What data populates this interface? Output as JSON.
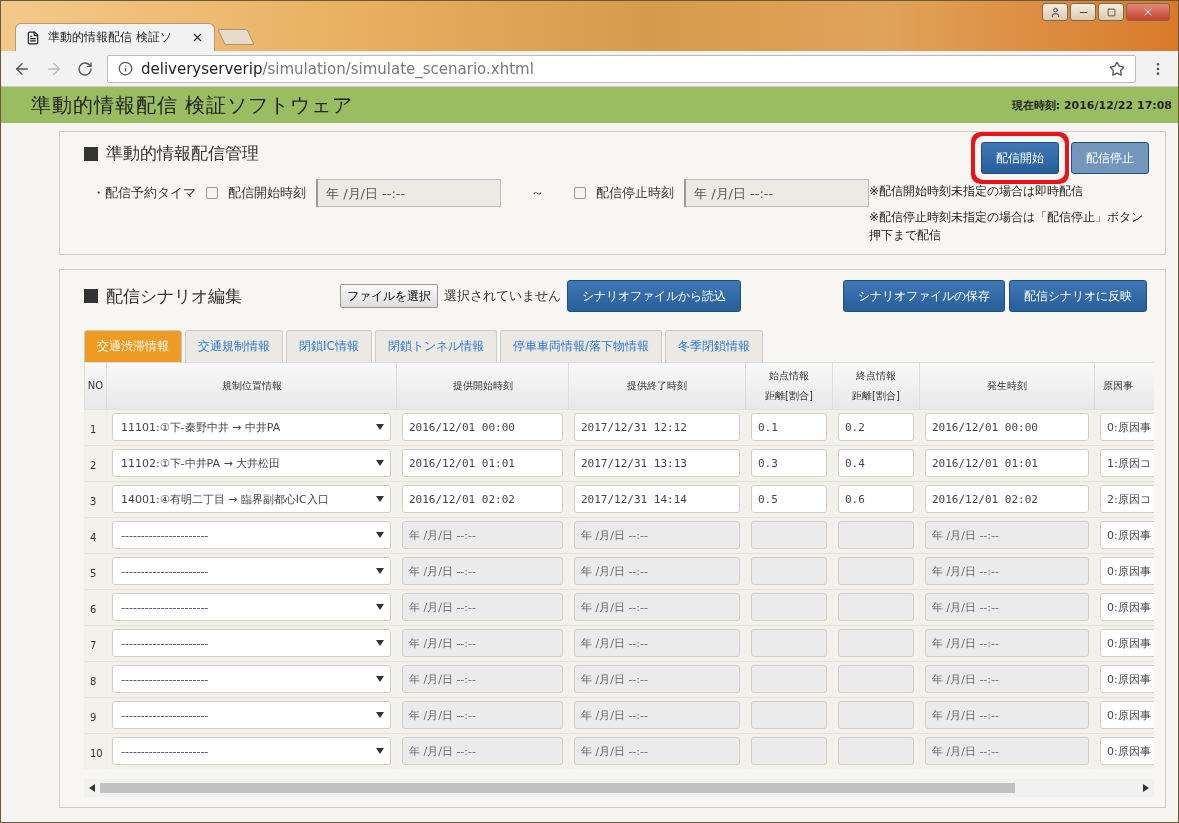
{
  "browser": {
    "tab_title": "準動的情報配信 検証ソ",
    "url_host": "deliveryserverip",
    "url_path": "/simulation/simulate_scenario.xhtml"
  },
  "header": {
    "title": "準動的情報配信 検証ソフトウェア",
    "clock_label": "現在時刻:",
    "clock_value": "2016/12/22 17:08"
  },
  "delivery": {
    "title": "準動的情報配信管理",
    "timer_label": "・配信予約タイマ",
    "timers": [
      {
        "label": "配信開始時刻",
        "checked": false,
        "placeholder": "年 /月/日 --:--"
      },
      {
        "label": "配信停止時刻",
        "checked": false,
        "placeholder": "年 /月/日 --:--"
      }
    ],
    "separator": "～",
    "buttons": [
      {
        "label": "配信開始",
        "highlighted": true,
        "disabled": false
      },
      {
        "label": "配信停止",
        "highlighted": false,
        "disabled": true
      }
    ],
    "notes": [
      "※配信開始時刻未指定の場合は即時配信",
      "※配信停止時刻未指定の場合は「配信停止」ボタン押下まで配信"
    ]
  },
  "scenario": {
    "title": "配信シナリオ編集",
    "file_button": "ファイルを選択",
    "file_status": "選択されていません",
    "load_button": "シナリオファイルから読込",
    "buttons": [
      "シナリオファイルの保存",
      "配信シナリオに反映"
    ],
    "tabs": [
      {
        "label": "交通渋滞情報",
        "selected": true
      },
      {
        "label": "交通規制情報",
        "selected": false
      },
      {
        "label": "閉鎖IC情報",
        "selected": false
      },
      {
        "label": "閉鎖トンネル情報",
        "selected": false
      },
      {
        "label": "停車車両情報/落下物情報",
        "selected": false
      },
      {
        "label": "冬季閉鎖情報",
        "selected": false
      }
    ],
    "columns": [
      {
        "label": "NO"
      },
      {
        "label": "規制位置情報"
      },
      {
        "label": "提供開始時刻"
      },
      {
        "label": "提供終了時刻"
      },
      {
        "label": "始点情報",
        "label_2": "距離[割合]"
      },
      {
        "label": "終点情報",
        "label_2": "距離[割合]"
      },
      {
        "label": "発生時刻"
      },
      {
        "label": "原因事"
      }
    ],
    "rows": [
      {
        "no": "1",
        "location": "11101:①下-秦野中井 → 中井PA",
        "start": "2016/12/01 00:00",
        "end": "2017/12/31 12:12",
        "start_dist": "0.1",
        "end_dist": "0.2",
        "occurred": "2016/12/01 00:00",
        "cause": "0:原因事",
        "disabled": false
      },
      {
        "no": "2",
        "location": "11102:①下-中井PA → 大井松田",
        "start": "2016/12/01 01:01",
        "end": "2017/12/31 13:13",
        "start_dist": "0.3",
        "end_dist": "0.4",
        "occurred": "2016/12/01 01:01",
        "cause": "1:原因コ",
        "disabled": false
      },
      {
        "no": "3",
        "location": "14001:④有明二丁目 → 臨界副都心IC入口",
        "start": "2016/12/01 02:02",
        "end": "2017/12/31 14:14",
        "start_dist": "0.5",
        "end_dist": "0.6",
        "occurred": "2016/12/01 02:02",
        "cause": "2:原因コ",
        "disabled": false
      },
      {
        "no": "4",
        "location": "----------------------",
        "start_placeholder": "年 /月/日 --:--",
        "end_placeholder": "年 /月/日 --:--",
        "occurred_placeholder": "年 /月/日 --:--",
        "cause": "0:原因事",
        "disabled": true
      },
      {
        "no": "5",
        "location": "----------------------",
        "start_placeholder": "年 /月/日 --:--",
        "end_placeholder": "年 /月/日 --:--",
        "occurred_placeholder": "年 /月/日 --:--",
        "cause": "0:原因事",
        "disabled": true
      },
      {
        "no": "6",
        "location": "----------------------",
        "start_placeholder": "年 /月/日 --:--",
        "end_placeholder": "年 /月/日 --:--",
        "occurred_placeholder": "年 /月/日 --:--",
        "cause": "0:原因事",
        "disabled": true
      },
      {
        "no": "7",
        "location": "----------------------",
        "start_placeholder": "年 /月/日 --:--",
        "end_placeholder": "年 /月/日 --:--",
        "occurred_placeholder": "年 /月/日 --:--",
        "cause": "0:原因事",
        "disabled": true
      },
      {
        "no": "8",
        "location": "----------------------",
        "start_placeholder": "年 /月/日 --:--",
        "end_placeholder": "年 /月/日 --:--",
        "occurred_placeholder": "年 /月/日 --:--",
        "cause": "0:原因事",
        "disabled": true
      },
      {
        "no": "9",
        "location": "----------------------",
        "start_placeholder": "年 /月/日 --:--",
        "end_placeholder": "年 /月/日 --:--",
        "occurred_placeholder": "年 /月/日 --:--",
        "cause": "0:原因事",
        "disabled": true
      },
      {
        "no": "10",
        "location": "----------------------",
        "start_placeholder": "年 /月/日 --:--",
        "end_placeholder": "年 /月/日 --:--",
        "occurred_placeholder": "年 /月/日 --:--",
        "cause": "0:原因事",
        "disabled": true
      }
    ]
  }
}
